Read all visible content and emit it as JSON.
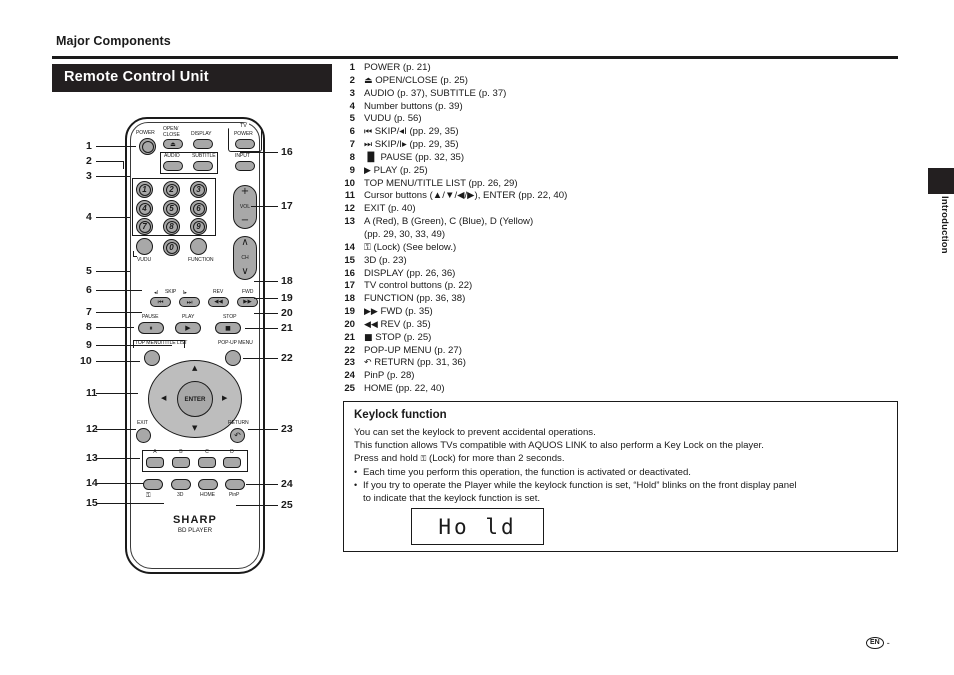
{
  "page": {
    "title": "Major Components",
    "section_heading": "Remote Control Unit",
    "side_tab": "Introduction",
    "footer_code": "EN",
    "footer_dash": "-"
  },
  "legend": {
    "items": [
      {
        "num": "1",
        "text": "POWER (p. 21)"
      },
      {
        "num": "2",
        "glyph": "⏏",
        "text": "OPEN/CLOSE (p. 25)"
      },
      {
        "num": "3",
        "text": "AUDIO (p. 37), SUBTITLE (p. 37)"
      },
      {
        "num": "4",
        "text": "Number buttons (p. 39)"
      },
      {
        "num": "5",
        "text": "VUDU (p. 56)"
      },
      {
        "num": "6",
        "glyph": "⏮",
        "text": "SKIP/◂I (pp. 29, 35)"
      },
      {
        "num": "7",
        "glyph": "⏭",
        "text": "SKIP/I▸ (pp. 29, 35)"
      },
      {
        "num": "8",
        "glyph": "▐▌",
        "text": "PAUSE (pp. 32, 35)"
      },
      {
        "num": "9",
        "glyph": "▶",
        "text": "PLAY (p. 25)"
      },
      {
        "num": "10",
        "text": "TOP MENU/TITLE LIST (pp. 26, 29)"
      },
      {
        "num": "11",
        "text": "Cursor buttons (▲/▼/◀/▶), ENTER (pp. 22, 40)"
      },
      {
        "num": "12",
        "text": "EXIT (p. 40)"
      },
      {
        "num": "13",
        "text": "A (Red), B (Green), C (Blue), D (Yellow)",
        "cont": "(pp. 29, 30, 33, 49)"
      },
      {
        "num": "14",
        "glyph": "⚿",
        "text": "(Lock) (See below.)"
      },
      {
        "num": "15",
        "text": "3D (p. 23)"
      },
      {
        "num": "16",
        "text": "DISPLAY (pp. 26, 36)"
      },
      {
        "num": "17",
        "text": "TV control buttons (p. 22)"
      },
      {
        "num": "18",
        "text": "FUNCTION (pp. 36, 38)"
      },
      {
        "num": "19",
        "glyph": "▶▶",
        "text": "FWD (p. 35)"
      },
      {
        "num": "20",
        "glyph": "◀◀",
        "text": "REV (p. 35)"
      },
      {
        "num": "21",
        "glyph": "■",
        "text": "STOP (p. 25)"
      },
      {
        "num": "22",
        "text": "POP-UP MENU (p. 27)"
      },
      {
        "num": "23",
        "glyph": "↶",
        "text": "RETURN (pp. 31, 36)"
      },
      {
        "num": "24",
        "text": "PinP (p. 28)"
      },
      {
        "num": "25",
        "text": "HOME (pp. 22, 40)"
      }
    ]
  },
  "keylock": {
    "title": "Keylock function",
    "line1": "You can set the keylock to prevent accidental operations.",
    "line2": "This function allows TVs compatible with AQUOS LINK to also perform a Key Lock on the player.",
    "line3_pre": "Press and hold ",
    "line3_glyph": "⚿",
    "line3_post": " (Lock) for more than 2 seconds.",
    "bullet_mark": "•",
    "bullet1": "Each time you perform this operation, the function is activated or deactivated.",
    "bullet2": "If you try to operate the Player while the keylock function is set, “Hold” blinks on the front display panel",
    "bullet2_cont": "to indicate that the keylock function is set.",
    "display_text": "Ho ld"
  },
  "remote": {
    "brand": "SHARP",
    "brand_sub": "BD PLAYER",
    "labels": {
      "power": "POWER",
      "open": "OPEN/",
      "close": "CLOSE",
      "display": "DISPLAY",
      "tv": "TV",
      "tv_power": "POWER",
      "tv_input": "INPUT",
      "audio": "AUDIO",
      "subtitle": "SUBTITLE",
      "vol": "VOL",
      "ch": "CH",
      "vudu": "VUDU",
      "function": "FUNCTION",
      "skip": "SKIP",
      "skip_prev": "◂I",
      "skip_next": "I▸",
      "rev": "REV",
      "fwd": "FWD",
      "pause": "PAUSE",
      "play": "PLAY",
      "stop": "STOP",
      "top_menu": "TOP MENU/TITLE LIST",
      "popup_menu": "POP-UP MENU",
      "enter": "ENTER",
      "exit": "EXIT",
      "return": "RETURN",
      "lock": "⚿",
      "three_d": "3D",
      "home": "HOME",
      "pinp": "PinP",
      "eject": "⏏",
      "plus": "+",
      "minus": "−",
      "chevron_up": "∧",
      "chevron_down": "∨",
      "arrow_up": "▲",
      "arrow_down": "▼",
      "arrow_left": "◀",
      "arrow_right": "▶",
      "pause_sym": "⏸",
      "play_sym": "▶",
      "stop_sym": "■",
      "prev_sym": "⏮",
      "next_sym": "⏭",
      "rev_sym": "◀◀",
      "fwd_sym": "▶▶",
      "return_sym": "↶"
    },
    "numbers": [
      "1",
      "2",
      "3",
      "4",
      "5",
      "6",
      "7",
      "8",
      "9",
      "0"
    ],
    "color_buttons": [
      "A",
      "B",
      "C",
      "D"
    ],
    "callouts_left": [
      "1",
      "2",
      "3",
      "4",
      "5",
      "6",
      "7",
      "8",
      "9",
      "10",
      "11",
      "12",
      "13",
      "14",
      "15"
    ],
    "callouts_right": [
      "16",
      "17",
      "18",
      "19",
      "20",
      "21",
      "22",
      "23",
      "24",
      "25"
    ]
  }
}
